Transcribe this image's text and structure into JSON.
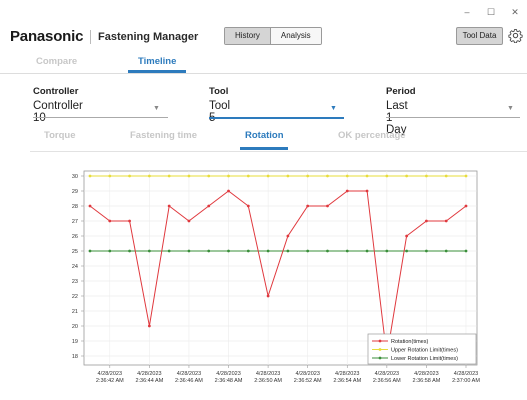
{
  "window": {
    "controls": [
      "–",
      "☐",
      "✕"
    ]
  },
  "header": {
    "brand": "Panasonic",
    "app_name": "Fastening Manager",
    "history_label": "History",
    "analysis_label": "Analysis",
    "tool_data_label": "Tool Data",
    "gear_icon": "gear-icon"
  },
  "view_tabs": {
    "compare": "Compare",
    "timeline": "Timeline",
    "active": "Timeline"
  },
  "filters": {
    "controller": {
      "label": "Controller",
      "value": "Controller 10"
    },
    "tool": {
      "label": "Tool",
      "value": "Tool 5"
    },
    "period": {
      "label": "Period",
      "value": "Last 1 Day"
    }
  },
  "metric_tabs": {
    "torque": "Torque",
    "fastening_time": "Fastening time",
    "rotation": "Rotation",
    "ok_percentage": "OK percentage",
    "active": "Rotation"
  },
  "chart_data": {
    "type": "line",
    "xlabel": "",
    "ylabel": "",
    "ylim": [
      18,
      30
    ],
    "yticks": [
      18,
      19,
      20,
      21,
      22,
      23,
      24,
      25,
      26,
      27,
      28,
      29,
      30
    ],
    "grid": true,
    "legend_position": "bottom-right",
    "x_tick_labels": [
      [
        "4/28/2023",
        "2:36:42 AM"
      ],
      [
        "4/28/2023",
        "2:36:44 AM"
      ],
      [
        "4/28/2023",
        "2:36:46 AM"
      ],
      [
        "4/28/2023",
        "2:36:48 AM"
      ],
      [
        "4/28/2023",
        "2:36:50 AM"
      ],
      [
        "4/28/2023",
        "2:36:52 AM"
      ],
      [
        "4/28/2023",
        "2:36:54 AM"
      ],
      [
        "4/28/2023",
        "2:36:56 AM"
      ],
      [
        "4/28/2023",
        "2:36:58 AM"
      ],
      [
        "4/28/2023",
        "2:37:00 AM"
      ]
    ],
    "series": [
      {
        "name": "Rotation(times)",
        "color": "#e0393e",
        "values": [
          28,
          27,
          27,
          20,
          28,
          27,
          28,
          29,
          28,
          22,
          26,
          28,
          28,
          29,
          29,
          18,
          26,
          27,
          27,
          28
        ]
      },
      {
        "name": "Upper Rotation Limit(times)",
        "color": "#e7dc3a",
        "values": [
          30,
          30,
          30,
          30,
          30,
          30,
          30,
          30,
          30,
          30,
          30,
          30,
          30,
          30,
          30,
          30,
          30,
          30,
          30,
          30
        ]
      },
      {
        "name": "Lower Rotation Limit(times)",
        "color": "#3a8f3a",
        "values": [
          25,
          25,
          25,
          25,
          25,
          25,
          25,
          25,
          25,
          25,
          25,
          25,
          25,
          25,
          25,
          25,
          25,
          25,
          25,
          25
        ]
      }
    ]
  }
}
